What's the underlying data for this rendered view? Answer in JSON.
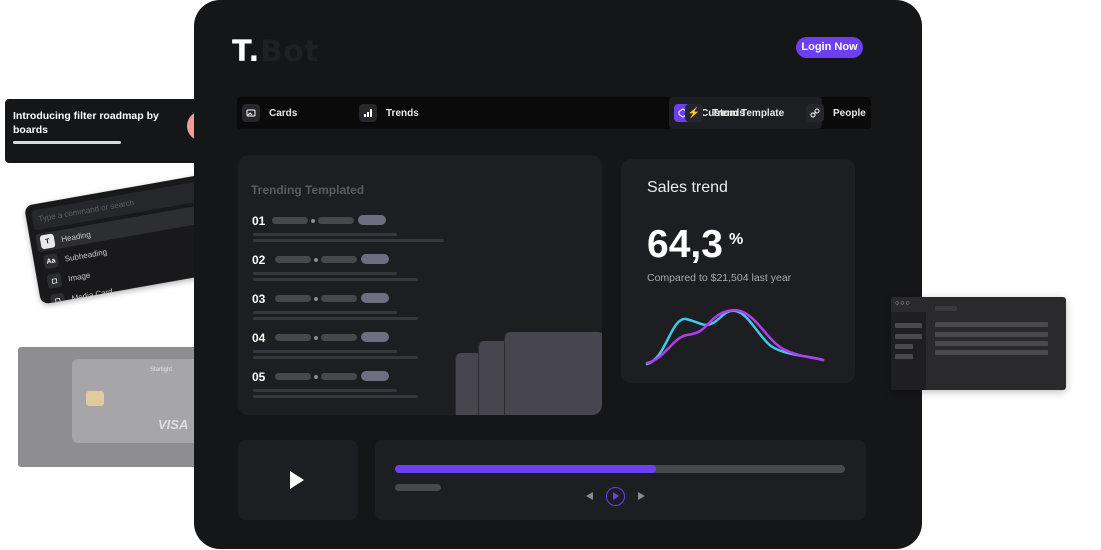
{
  "header": {
    "logo_main": "T.",
    "logo_faded": "Bot",
    "login_label": "Login Now"
  },
  "tabs": [
    {
      "label": "Cards",
      "icon": "image-icon"
    },
    {
      "label": "Trends",
      "icon": "bar-chart-icon"
    },
    {
      "label": "Custom Template",
      "icon": "template-icon",
      "active": true
    },
    {
      "label": "Trends",
      "icon": "bolt-icon"
    },
    {
      "label": "People",
      "icon": "link-icon"
    }
  ],
  "trending": {
    "title": "Trending Templated",
    "rows": [
      "01",
      "02",
      "03",
      "04",
      "05"
    ]
  },
  "sales": {
    "title": "Sales trend",
    "value": "64,3",
    "unit": "%",
    "comparison": "Compared to $21,504 last year"
  },
  "notification": {
    "text": "Introducing filter roadmap by boards"
  },
  "command_menu": {
    "placeholder": "Type a command or search",
    "items": [
      {
        "key": "T",
        "label": "Heading"
      },
      {
        "key": "Aa",
        "label": "Subheading"
      },
      {
        "key": "◻",
        "label": "Image"
      },
      {
        "key": "◻",
        "label": "Media Card"
      }
    ]
  },
  "credit_card": {
    "brand": "VISA",
    "issuer": "Starlight"
  },
  "player": {
    "progress": 0.58
  },
  "colors": {
    "accent": "#6d3ff3",
    "panel": "#1d1e21",
    "device": "#151618",
    "line_cyan": "#3fc9e8",
    "line_purple": "#b23cf5"
  }
}
